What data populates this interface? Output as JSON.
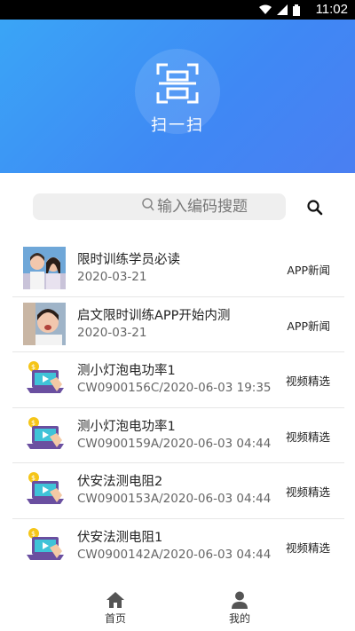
{
  "status_bar": {
    "time": "11:02",
    "icons": [
      "wifi-icon",
      "signal-icon",
      "battery-icon"
    ]
  },
  "hero": {
    "scan_label": "扫一扫",
    "icon": "scan-icon"
  },
  "search": {
    "placeholder": "输入编码搜题"
  },
  "list": [
    {
      "title": "限时训练学员必读",
      "subtitle": "2020-03-21",
      "tag": "APP新闻",
      "thumb": "photo-students-icon"
    },
    {
      "title": "启文限时训练APP开始内测",
      "subtitle": "2020-03-21",
      "tag": "APP新闻",
      "thumb": "photo-student-cheer-icon"
    },
    {
      "title": "测小灯泡电功率1",
      "subtitle": "CW0900156C/2020-06-03 19:35:",
      "tag": "视频精选",
      "thumb": "laptop-video-icon"
    },
    {
      "title": "测小灯泡电功率1",
      "subtitle": "CW0900159A/2020-06-03 04:44:",
      "tag": "视频精选",
      "thumb": "laptop-video-icon"
    },
    {
      "title": "伏安法测电阻2",
      "subtitle": "CW0900153A/2020-06-03 04:44:",
      "tag": "视频精选",
      "thumb": "laptop-video-icon"
    },
    {
      "title": "伏安法测电阻1",
      "subtitle": "CW0900142A/2020-06-03 04:44:",
      "tag": "视频精选",
      "thumb": "laptop-video-icon"
    }
  ],
  "nav": {
    "home_label": "首页",
    "mine_label": "我的"
  },
  "colors": {
    "hero_start": "#3aa5f6",
    "hero_end": "#4a7ff2",
    "nav_icon": "#555555"
  }
}
